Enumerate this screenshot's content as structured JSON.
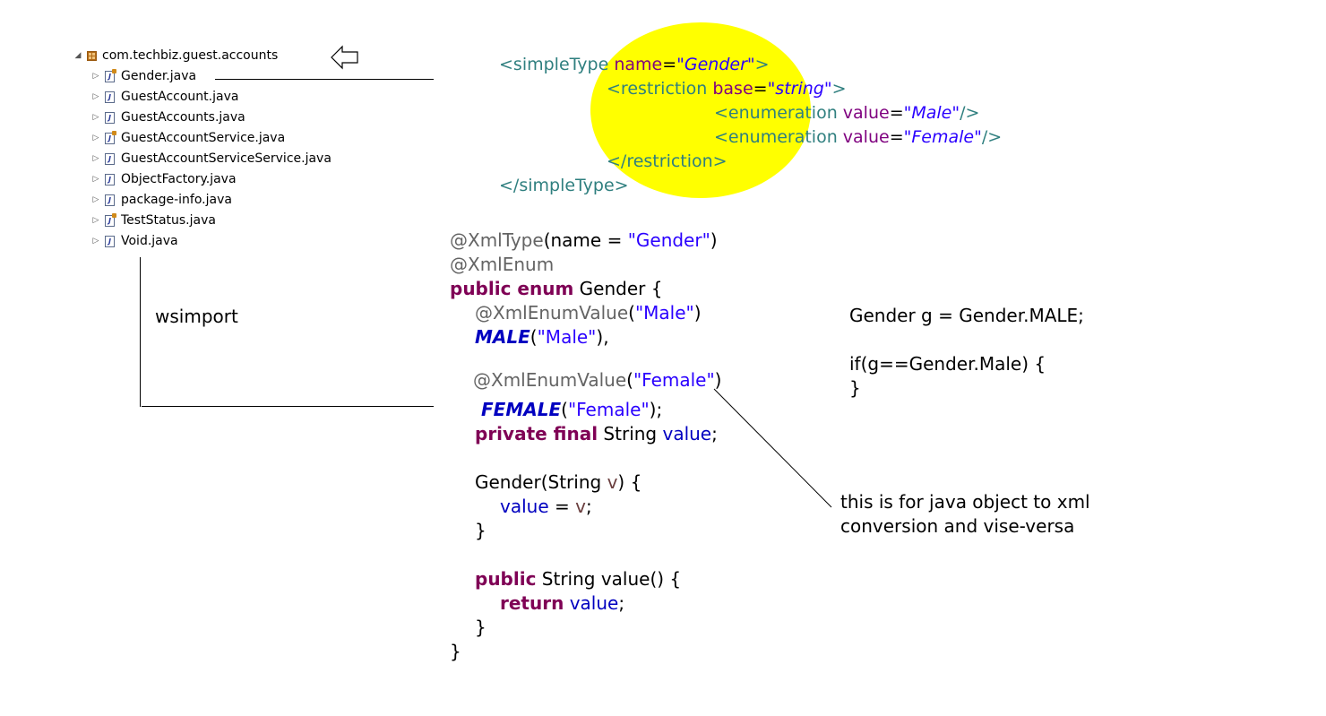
{
  "tree": {
    "package": "com.techbiz.guest.accounts",
    "files": [
      {
        "name": "Gender.java",
        "icon": "enum-file-icon"
      },
      {
        "name": "GuestAccount.java",
        "icon": "java-file-icon"
      },
      {
        "name": "GuestAccounts.java",
        "icon": "java-file-icon"
      },
      {
        "name": "GuestAccountService.java",
        "icon": "interface-file-icon"
      },
      {
        "name": "GuestAccountServiceService.java",
        "icon": "java-file-icon"
      },
      {
        "name": "ObjectFactory.java",
        "icon": "java-file-icon"
      },
      {
        "name": "package-info.java",
        "icon": "java-file-icon"
      },
      {
        "name": "TestStatus.java",
        "icon": "enum-file-icon"
      },
      {
        "name": "Void.java",
        "icon": "java-file-icon"
      }
    ]
  },
  "xml": {
    "l1": {
      "open": "<simpleType",
      "attr": "name",
      "eq": "=",
      "val": "\"Gender\"",
      "close": ">"
    },
    "l2": {
      "open": "<restriction",
      "attr": "base",
      "eq": "=",
      "val": "\"string\"",
      "close": ">"
    },
    "l3": {
      "open": "<enumeration",
      "attr": "value",
      "eq": "=",
      "val": "\"Male\"",
      "close": "/>"
    },
    "l4": {
      "open": "<enumeration",
      "attr": "value",
      "eq": "=",
      "val": "\"Female\"",
      "close": "/>"
    },
    "l5": "</restriction>",
    "l6": "</simpleType>"
  },
  "java": {
    "l1": {
      "ann": "@XmlType",
      "a": "(name = ",
      "str": "\"Gender\"",
      "b": ")"
    },
    "l2": "@XmlEnum",
    "l3": {
      "kw": "public enum",
      "rest": " Gender {"
    },
    "l4": {
      "ann": "@XmlEnumValue",
      "a": "(",
      "str": "\"Male\"",
      "b": ")"
    },
    "l5": {
      "const": "MALE",
      "a": "(",
      "str": "\"Male\"",
      "b": "),"
    },
    "l6": {
      "ann": "@XmlEnumValue",
      "a": "(",
      "str": "\"Female\"",
      "b": ")"
    },
    "l7": {
      "const": "FEMALE",
      "a": "(",
      "str": "\"Female\"",
      "b": ");"
    },
    "l8": {
      "kw": "private final",
      "type": " String ",
      "field": "value",
      "end": ";"
    },
    "l9": {
      "a": "Gender(String ",
      "param": "v",
      "b": ") {"
    },
    "l10": {
      "field": "value",
      "eq": " = ",
      "param": "v",
      "end": ";"
    },
    "l11": "}",
    "l12": {
      "kw": "public",
      "rest": " String value() {"
    },
    "l13": {
      "kw": "return",
      "sp": " ",
      "field": "value",
      "end": ";"
    },
    "l14": "}",
    "l15": "}"
  },
  "wsimport_label": "wsimport",
  "usage": {
    "line1": "Gender g = Gender.MALE;",
    "line2": "if(g==Gender.Male) {",
    "line3": "}"
  },
  "note": {
    "line1": "this is for java object to xml",
    "line2": "conversion and vise-versa"
  },
  "colors": {
    "highlight": "#ffff00",
    "xml_tag": "#2f7f7f",
    "xml_attr": "#7f007f",
    "xml_value": "#2a00ff",
    "java_keyword": "#7f0055",
    "java_string": "#2a00ff",
    "java_annotation": "#646464",
    "java_constant": "#0000c0"
  }
}
